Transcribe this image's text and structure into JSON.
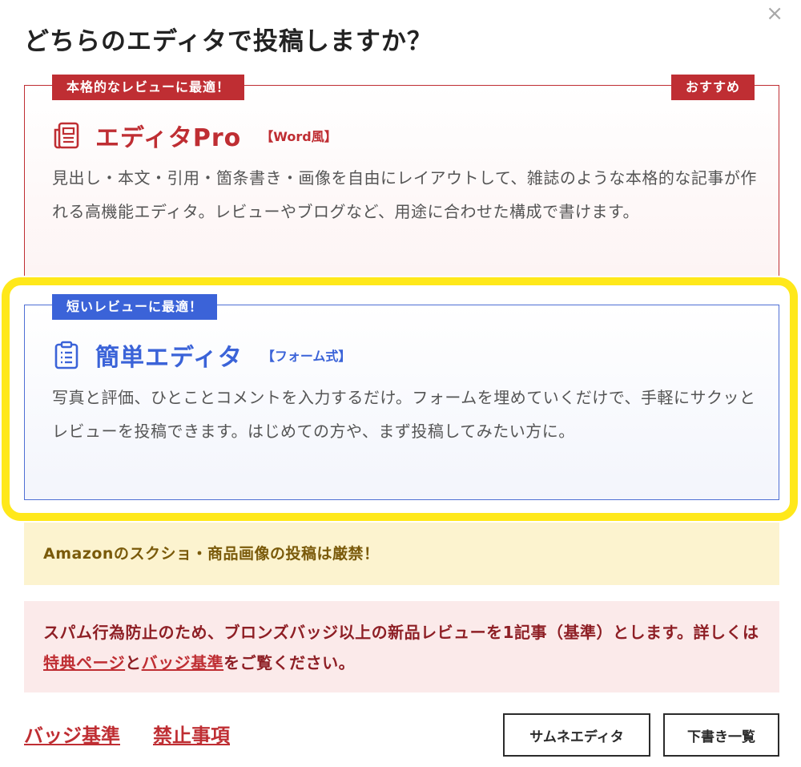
{
  "modal": {
    "title": "どちらのエディタで投稿しますか？",
    "close_label": "×"
  },
  "editor_pro": {
    "tag_left": "本格的なレビューに最適！",
    "tag_right": "おすすめ",
    "name": "エディタPro",
    "kind": "【Word風】",
    "icon": "document-icon",
    "description": "見出し・本文・引用・箇条書き・画像を自由にレイアウトして、雑誌のような本格的な記事が作れる高機能エディタ。レビューやブログなど、用途に合わせた構成で書けます。",
    "accent_color": "#bf2e33"
  },
  "editor_simple": {
    "tag": "短いレビューに最適！",
    "name": "簡単エディタ",
    "kind": "【フォーム式】",
    "icon": "clipboard-icon",
    "description": "写真と評価、ひとことコメントを入力するだけ。フォームを埋めていくだけで、手軽にサクッとレビューを投稿できます。はじめての方や、まず投稿してみたい方に。",
    "accent_color": "#3b63d8"
  },
  "notice_amazon": "Amazonのスクショ・商品画像の投稿は厳禁！",
  "notice_spam": {
    "text_before": "スパム行為防止のため、ブロンズバッジ以上の新品レビューを1記事（基準）とします。詳しくは",
    "link_benefits": "特典ページ",
    "text_middle": "と",
    "link_badge": "バッジ基準",
    "text_after": "をご覧ください。"
  },
  "footer": {
    "link_badge": "バッジ基準",
    "link_ban": "禁止事項",
    "button_thumb": "サムネエディタ",
    "button_drafts": "下書き一覧"
  },
  "highlight_color": "#ffe81a"
}
